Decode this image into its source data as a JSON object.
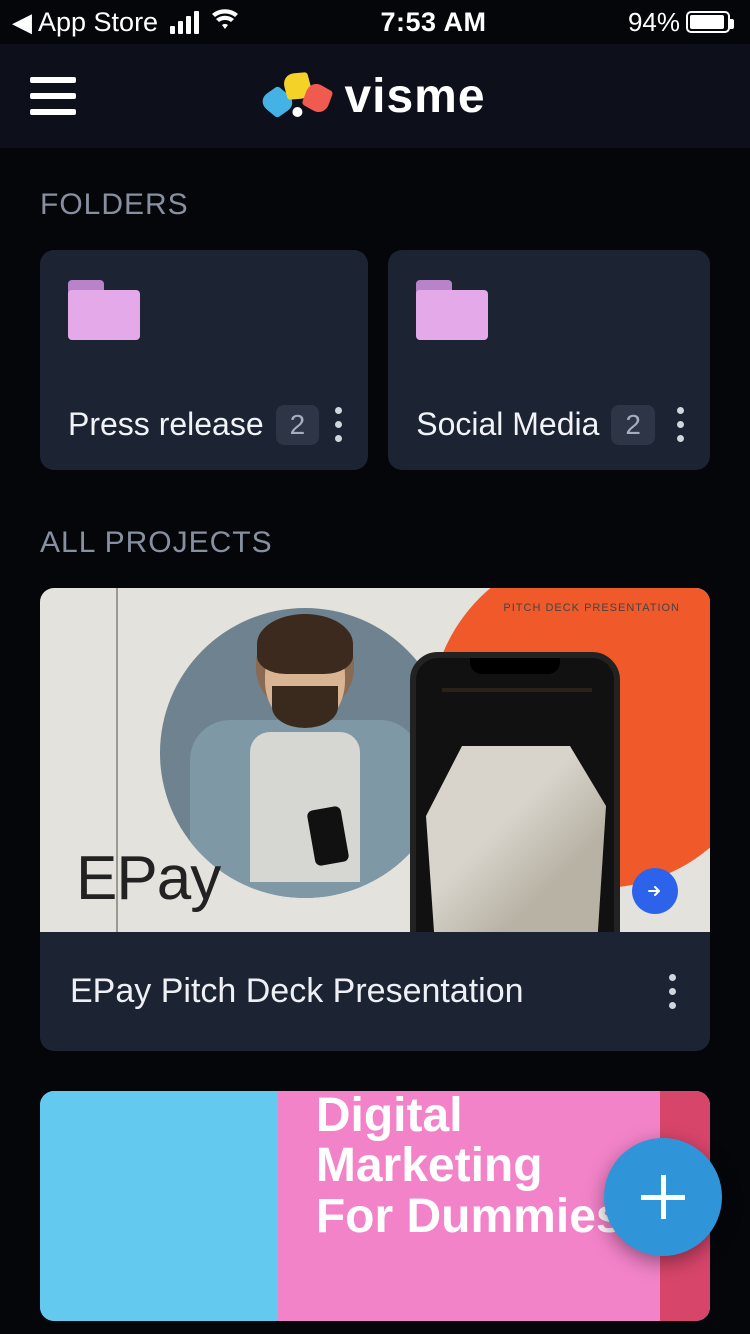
{
  "status": {
    "back_label": "App Store",
    "time": "7:53 AM",
    "battery_pct": "94%"
  },
  "header": {
    "brand": "visme"
  },
  "sections": {
    "folders_title": "FOLDERS",
    "projects_title": "ALL PROJECTS"
  },
  "folders": [
    {
      "name": "Press release",
      "count": "2"
    },
    {
      "name": "Social Media",
      "count": "2"
    }
  ],
  "projects": [
    {
      "title": "EPay Pitch Deck Presentation",
      "thumb_label": "EPay",
      "thumb_badge": "PITCH DECK PRESENTATION"
    },
    {
      "title": "Digital Marketing For Dummies",
      "thumb_lines": [
        "Digital",
        "Marketing",
        "For Dummies"
      ]
    }
  ]
}
